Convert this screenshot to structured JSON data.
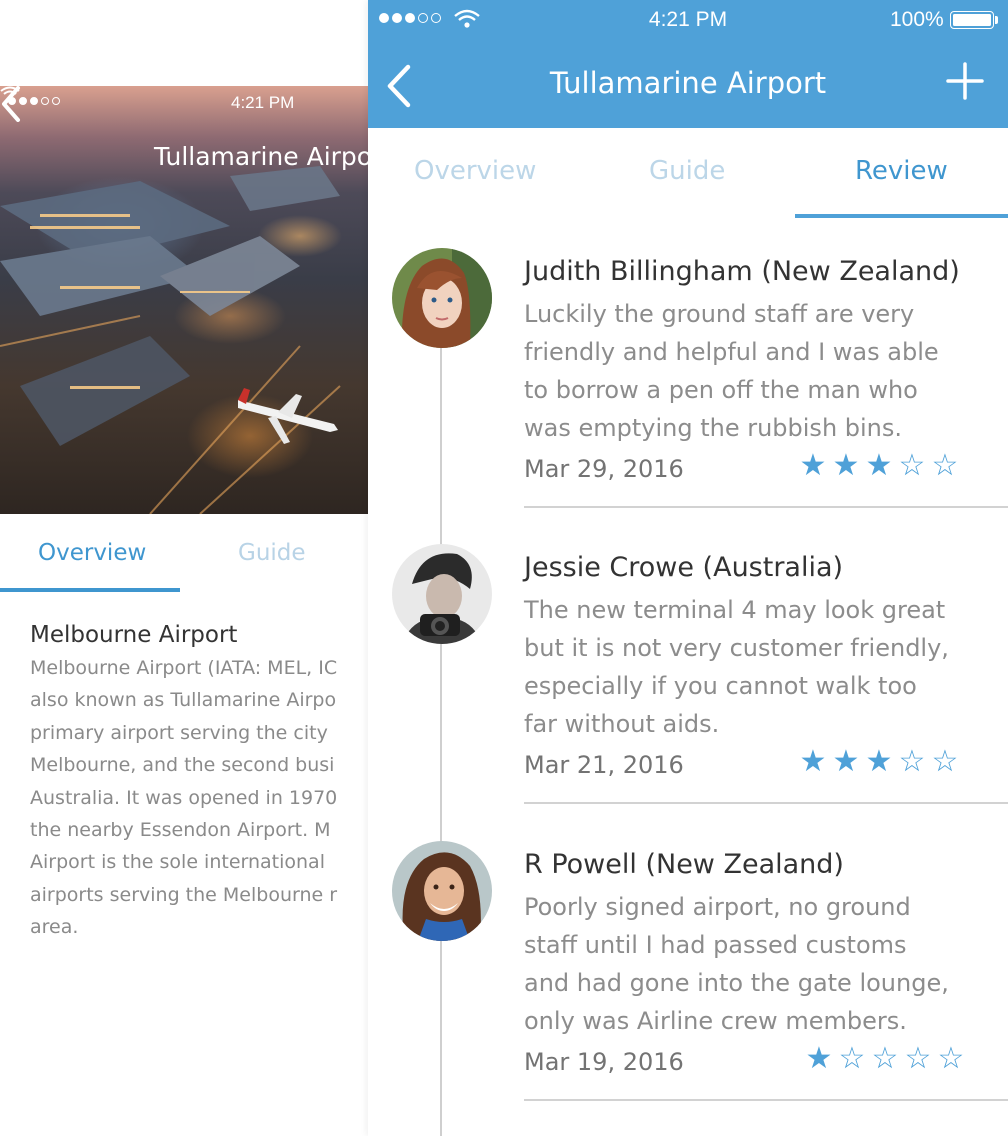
{
  "back_screen": {
    "status": {
      "time": "4:21 PM"
    },
    "nav": {
      "title": "Tullamarine Airport"
    },
    "tabs": [
      "Overview",
      "Guide"
    ],
    "heading": "Melbourne Airport",
    "body": "Melbourne Airport (IATA: MEL, IC\nalso known as Tullamarine Airpo\nprimary airport serving the city\nMelbourne, and the second busi\nAustralia. It was opened in 1970\nthe nearby Essendon Airport. M\nAirport is the sole international\nairports serving the Melbourne r\narea."
  },
  "front_screen": {
    "status": {
      "time": "4:21 PM",
      "battery": "100%"
    },
    "nav": {
      "title": "Tullamarine Airport",
      "back_icon": "chevron-left-icon",
      "add_icon": "plus-icon"
    },
    "tabs": [
      {
        "label": "Overview",
        "active": false
      },
      {
        "label": "Guide",
        "active": false
      },
      {
        "label": "Review",
        "active": true
      }
    ],
    "reviews": [
      {
        "name": "Judith Billingham (New Zealand)",
        "text": "Luckily the ground staff are very\nfriendly and helpful and I was able\nto borrow a pen off the man who\nwas emptying the rubbish bins.",
        "date": "Mar 29, 2016",
        "rating": 3,
        "max_rating": 5
      },
      {
        "name": "Jessie Crowe (Australia)",
        "text": "The new terminal 4 may look great\nbut it is not very customer friendly,\nespecially if you cannot walk too\nfar without aids.",
        "date": "Mar 21, 2016",
        "rating": 3,
        "max_rating": 5
      },
      {
        "name": "R Powell (New Zealand)",
        "text": "Poorly signed airport, no ground\nstaff until I had passed customs\nand had gone into the gate lounge,\nonly was Airline crew members.",
        "date": "Mar 19, 2016",
        "rating": 1,
        "max_rating": 5
      }
    ]
  },
  "colors": {
    "accent": "#4fa1d8",
    "tab_active": "#3f96cf",
    "tab_inactive": "#bcd6e8"
  }
}
